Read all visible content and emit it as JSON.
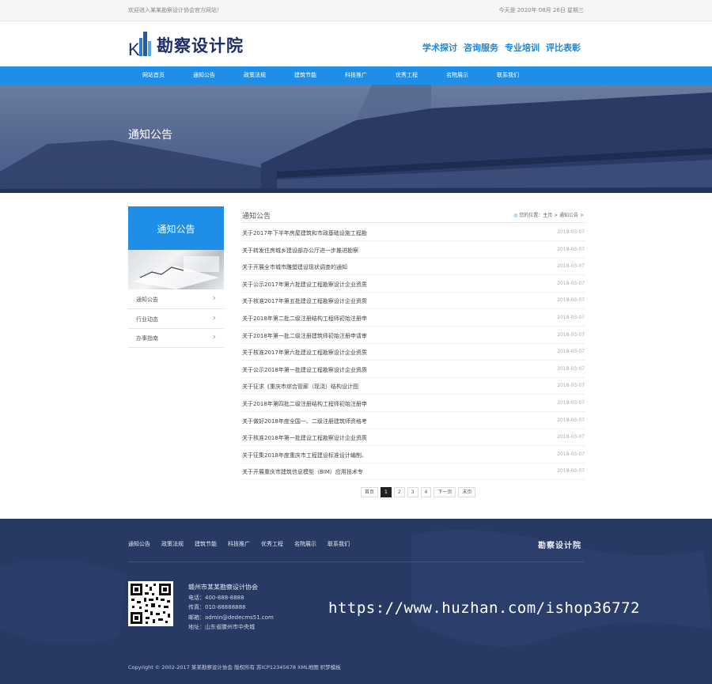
{
  "topbar": {
    "welcome": "欢迎进入某某勘察设计协会官方网站！",
    "date": "今天是 2020年 08月 26日 星期三"
  },
  "header": {
    "logo_text": "勘察设计院",
    "links": [
      "学术探讨",
      "咨询服务",
      "专业培训",
      "评比表彰"
    ],
    "brand_color": "#1f8ee6"
  },
  "nav": {
    "items": [
      "网站首页",
      "通知公告",
      "政策法规",
      "建筑节能",
      "科技推广",
      "优秀工程",
      "名院展示",
      "联系我们"
    ]
  },
  "banner": {
    "title": "通知公告"
  },
  "sidebar": {
    "heading": "通知公告",
    "items": [
      "通知公告",
      "行业动态",
      "办事指南"
    ]
  },
  "list": {
    "title": "通知公告",
    "breadcrumb": "您的位置：主页 > 通知公告 >",
    "rows": [
      {
        "title": "关于2017年下半年房屋建筑和市政基础设施工程勘",
        "date": "2018-03-07"
      },
      {
        "title": "关于转发住房城乡建设部办公厅进一步推进勘察",
        "date": "2018-03-07"
      },
      {
        "title": "关于开展全市城市雕塑建设现状调查的通知",
        "date": "2018-03-07"
      },
      {
        "title": "关于公示2017年第六批建设工程勘察设计企业资质",
        "date": "2018-03-07"
      },
      {
        "title": "关于核准2017年第五批建设工程勘察设计企业资质",
        "date": "2018-03-07"
      },
      {
        "title": "关于2018年第二批二级注册结构工程师初始注册申",
        "date": "2018-03-07"
      },
      {
        "title": "关于2018年第一批二级注册建筑师初始注册申请审",
        "date": "2018-03-07"
      },
      {
        "title": "关于核准2017年第六批建设工程勘察设计企业资质",
        "date": "2018-03-07"
      },
      {
        "title": "关于公示2018年第一批建设工程勘察设计企业资质",
        "date": "2018-03-07"
      },
      {
        "title": "关于征求《重庆市综合管廊（现浇）结构设计图",
        "date": "2018-03-07"
      },
      {
        "title": "关于2018年第四批二级注册结构工程师初始注册申",
        "date": "2018-03-07"
      },
      {
        "title": "关于做好2018年度全国一、二级注册建筑师资格考",
        "date": "2018-03-07"
      },
      {
        "title": "关于核准2018年第一批建设工程勘察设计企业资质",
        "date": "2018-03-07"
      },
      {
        "title": "关于征集2018年度重庆市工程建设标准设计编制、",
        "date": "2018-03-07"
      },
      {
        "title": "关于开展重庆市建筑信息模型（BIM）应用技术专",
        "date": "2018-03-07"
      }
    ]
  },
  "pagination": {
    "items": [
      "首页",
      "1",
      "2",
      "3",
      "4",
      "下一页",
      "末页"
    ],
    "current": "1"
  },
  "footer": {
    "nav": [
      "通知公告",
      "政策法规",
      "建筑节能",
      "科技推广",
      "优秀工程",
      "名院展示",
      "联系我们"
    ],
    "logo_text": "勘察设计院",
    "org_name": "赣州市某某勘察设计协会",
    "phone": "电话：400-888-8888",
    "fax": "传真：010-88888888",
    "email": "邮箱：admin@dedecms51.com",
    "address": "地址：山东省滕州市中央城",
    "copyright": "Copyright © 2002-2017 某某勘察设计协会 版权所有  苏ICP12345678  XML地图  织梦模板",
    "watermark": "https://www.huzhan.com/ishop36772",
    "bg_color": "#283a64"
  }
}
